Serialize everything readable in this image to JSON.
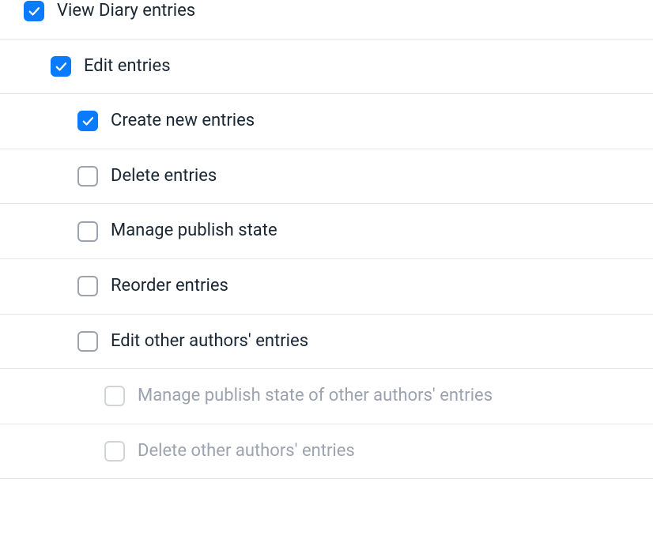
{
  "permissions": {
    "view_diary_entries": {
      "label": "View Diary entries",
      "checked": true,
      "disabled": false
    },
    "edit_entries": {
      "label": "Edit entries",
      "checked": true,
      "disabled": false
    },
    "create_new_entries": {
      "label": "Create new entries",
      "checked": true,
      "disabled": false
    },
    "delete_entries": {
      "label": "Delete entries",
      "checked": false,
      "disabled": false
    },
    "manage_publish_state": {
      "label": "Manage publish state",
      "checked": false,
      "disabled": false
    },
    "reorder_entries": {
      "label": "Reorder entries",
      "checked": false,
      "disabled": false
    },
    "edit_other_authors_entries": {
      "label": "Edit other authors' entries",
      "checked": false,
      "disabled": false
    },
    "manage_publish_state_other_authors": {
      "label": "Manage publish state of other authors' entries",
      "checked": false,
      "disabled": true
    },
    "delete_other_authors_entries": {
      "label": "Delete other authors' entries",
      "checked": false,
      "disabled": true
    }
  }
}
